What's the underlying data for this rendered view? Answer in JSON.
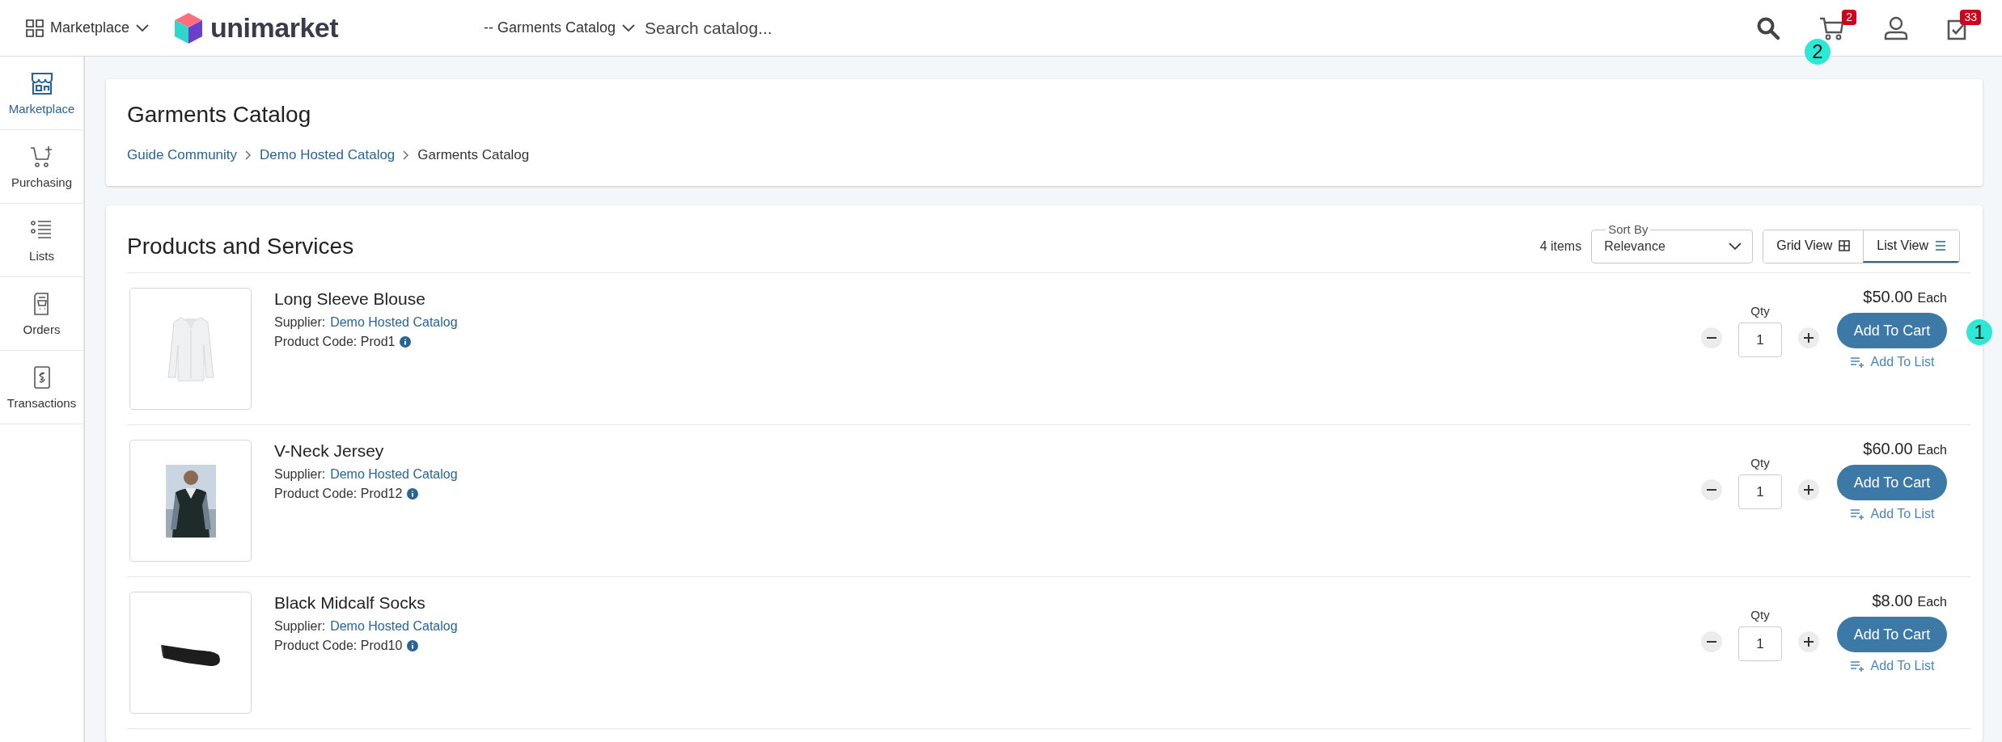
{
  "topbar": {
    "app_menu": "Marketplace",
    "logo": "unimarket",
    "catalog_select": "-- Garments Catalog",
    "search": {
      "placeholder": "Search catalog..."
    },
    "cart": {
      "badge": "2",
      "callout": "2"
    },
    "tasks": {
      "badge": "33"
    }
  },
  "sidebar": {
    "items": [
      {
        "label": "Marketplace",
        "kind": "store",
        "selected": true
      },
      {
        "label": "Purchasing",
        "kind": "cart",
        "selected": false
      },
      {
        "label": "Lists",
        "kind": "list",
        "selected": false
      },
      {
        "label": "Orders",
        "kind": "orders",
        "selected": false
      },
      {
        "label": "Transactions",
        "kind": "transactions",
        "selected": false
      }
    ]
  },
  "header": {
    "title": "Garments Catalog",
    "breadcrumb": [
      {
        "label": "Guide Community",
        "link": true
      },
      {
        "label": "Demo Hosted Catalog",
        "link": true
      },
      {
        "label": "Garments Catalog",
        "link": false
      }
    ]
  },
  "products_section": {
    "title": "Products and Services",
    "count": "4 items",
    "sort": {
      "label": "Sort By",
      "value": "Relevance"
    },
    "views": [
      {
        "label": "Grid View",
        "kind": "grid",
        "selected": false
      },
      {
        "label": "List View",
        "kind": "list",
        "selected": true
      }
    ]
  },
  "products": [
    {
      "name": "Long Sleeve Blouse",
      "supplier_label": "Supplier:",
      "supplier": "Demo Hosted Catalog",
      "code": "Product Code: Prod1",
      "qty_label": "Qty",
      "qty": "1",
      "price": "$50.00",
      "unit": "Each",
      "add_to_cart": "Add To Cart",
      "add_to_list": "Add To List",
      "callout": "1"
    },
    {
      "name": "V-Neck Jersey",
      "supplier_label": "Supplier:",
      "supplier": "Demo Hosted Catalog",
      "code": "Product Code: Prod12",
      "qty_label": "Qty",
      "qty": "1",
      "price": "$60.00",
      "unit": "Each",
      "add_to_cart": "Add To Cart",
      "add_to_list": "Add To List"
    },
    {
      "name": "Black Midcalf Socks",
      "supplier_label": "Supplier:",
      "supplier": "Demo Hosted Catalog",
      "code": "Product Code: Prod10",
      "qty_label": "Qty",
      "qty": "1",
      "price": "$8.00",
      "unit": "Each",
      "add_to_cart": "Add To Cart",
      "add_to_list": "Add To List"
    }
  ]
}
